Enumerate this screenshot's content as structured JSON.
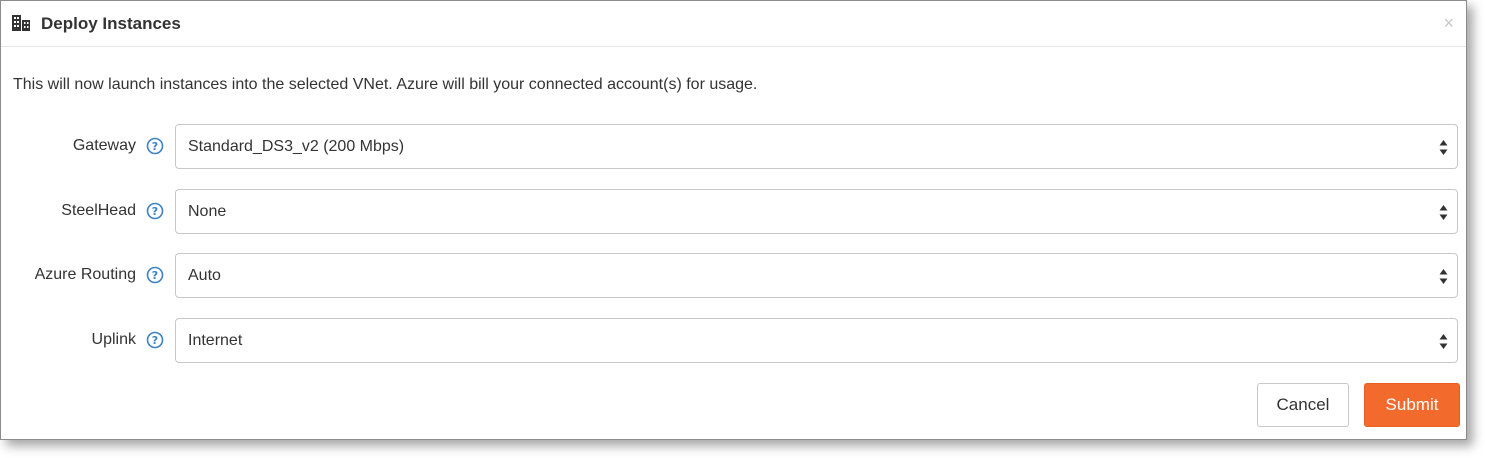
{
  "dialog": {
    "title": "Deploy Instances",
    "close_label": "×",
    "title_icon": "building-icon",
    "close_icon": "close-icon"
  },
  "intro_text": "This will now launch instances into the selected VNet. Azure will bill your connected account(s) for usage.",
  "fields": [
    {
      "label": "Gateway",
      "value": "Standard_DS3_v2 (200 Mbps)"
    },
    {
      "label": "SteelHead",
      "value": "None"
    },
    {
      "label": "Azure Routing",
      "value": "Auto"
    },
    {
      "label": "Uplink",
      "value": "Internet"
    }
  ],
  "buttons": {
    "cancel": "Cancel",
    "submit": "Submit"
  },
  "colors": {
    "accent": "#f26b2d",
    "help_icon": "#3d82c4",
    "border": "#c8c8c8",
    "text": "#333333"
  },
  "icons": {
    "help": "question-circle-icon",
    "select_arrows": "sort-arrows-icon"
  }
}
